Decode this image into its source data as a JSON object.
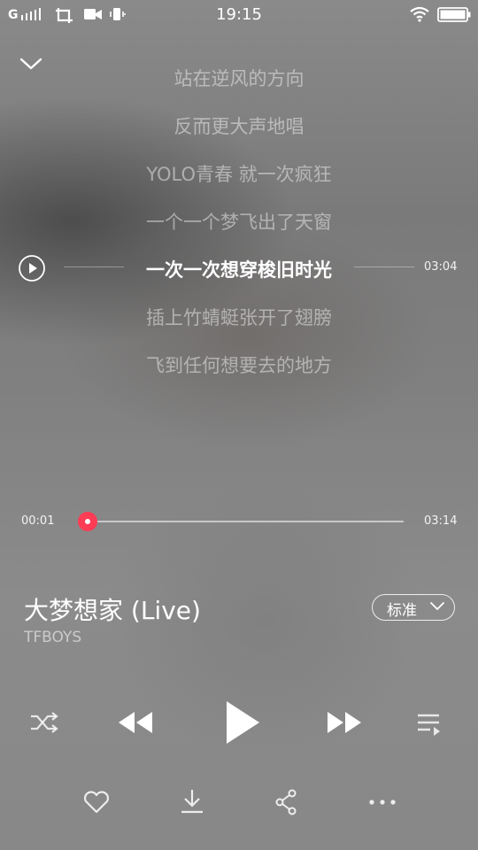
{
  "status_bar": {
    "carrier": "G",
    "time": "19:15"
  },
  "lyrics": {
    "lines": [
      "站在逆风的方向",
      "反而更大声地唱",
      "YOLO青春 就一次疯狂",
      "一个一个梦飞出了天窗",
      "一次一次想穿梭旧时光",
      "插上竹蜻蜓张开了翅膀",
      "飞到任何想要去的地方"
    ],
    "current_index": 4,
    "current_line_time": "03:04"
  },
  "player": {
    "elapsed": "00:01",
    "duration": "03:14",
    "progress_fraction": 0.005,
    "song_title": "大梦想家 (Live)",
    "artist": "TFBOYS",
    "quality_label": "标准"
  },
  "colors": {
    "accent": "#ff3c55"
  },
  "icons": {
    "collapse": "chevron-down-icon",
    "lyric_play": "play-circle-icon",
    "shuffle": "shuffle-icon",
    "previous": "previous-icon",
    "play": "play-icon",
    "next": "next-icon",
    "playlist": "playlist-icon",
    "like": "heart-icon",
    "download": "download-icon",
    "share": "share-icon",
    "more": "more-icon"
  }
}
